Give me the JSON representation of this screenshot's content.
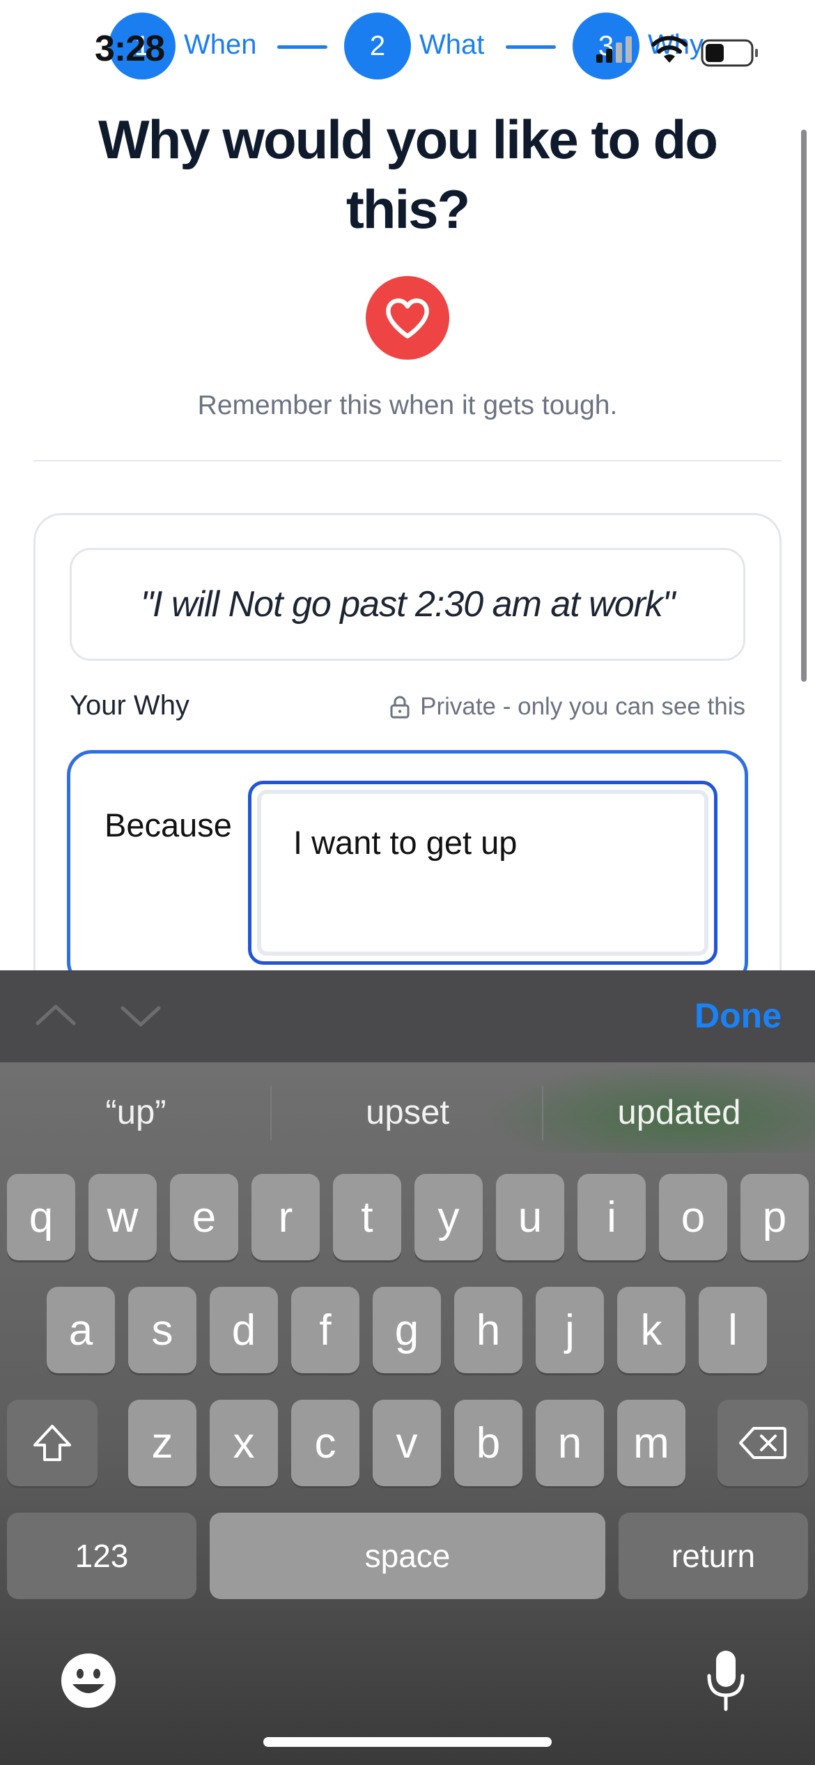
{
  "status_bar": {
    "time": "3:28"
  },
  "stepper": {
    "steps": [
      {
        "number": "1",
        "label": "When"
      },
      {
        "number": "2",
        "label": "What"
      },
      {
        "number": "3",
        "label": "Why"
      }
    ]
  },
  "header": {
    "title": "Why would you like to do this?",
    "subtitle": "Remember this when it gets tough."
  },
  "card": {
    "quote": "\"I will Not go past 2:30 am at work\"",
    "your_why_label": "Your Why",
    "private_note": "Private - only you can see this",
    "because_label": "Because",
    "because_input_value": "I want to get up"
  },
  "keyboard_toolbar": {
    "done_label": "Done"
  },
  "keyboard": {
    "suggestions": [
      "“up”",
      "upset",
      "updated"
    ],
    "row1": [
      "q",
      "w",
      "e",
      "r",
      "t",
      "y",
      "u",
      "i",
      "o",
      "p"
    ],
    "row2": [
      "a",
      "s",
      "d",
      "f",
      "g",
      "h",
      "j",
      "k",
      "l"
    ],
    "row3": [
      "z",
      "x",
      "c",
      "v",
      "b",
      "n",
      "m"
    ],
    "numbers_label": "123",
    "space_label": "space",
    "return_label": "return"
  },
  "colors": {
    "accent": "#1b7ef0",
    "heart": "#ee4444",
    "focus_border": "#2f6fe0",
    "done": "#1b82f5"
  },
  "icons": [
    "heart-icon",
    "lock-icon",
    "chevron-up-icon",
    "chevron-down-icon",
    "shift-icon",
    "backspace-icon",
    "emoji-icon",
    "microphone-icon",
    "cellular-signal-icon",
    "wifi-icon",
    "battery-icon"
  ]
}
